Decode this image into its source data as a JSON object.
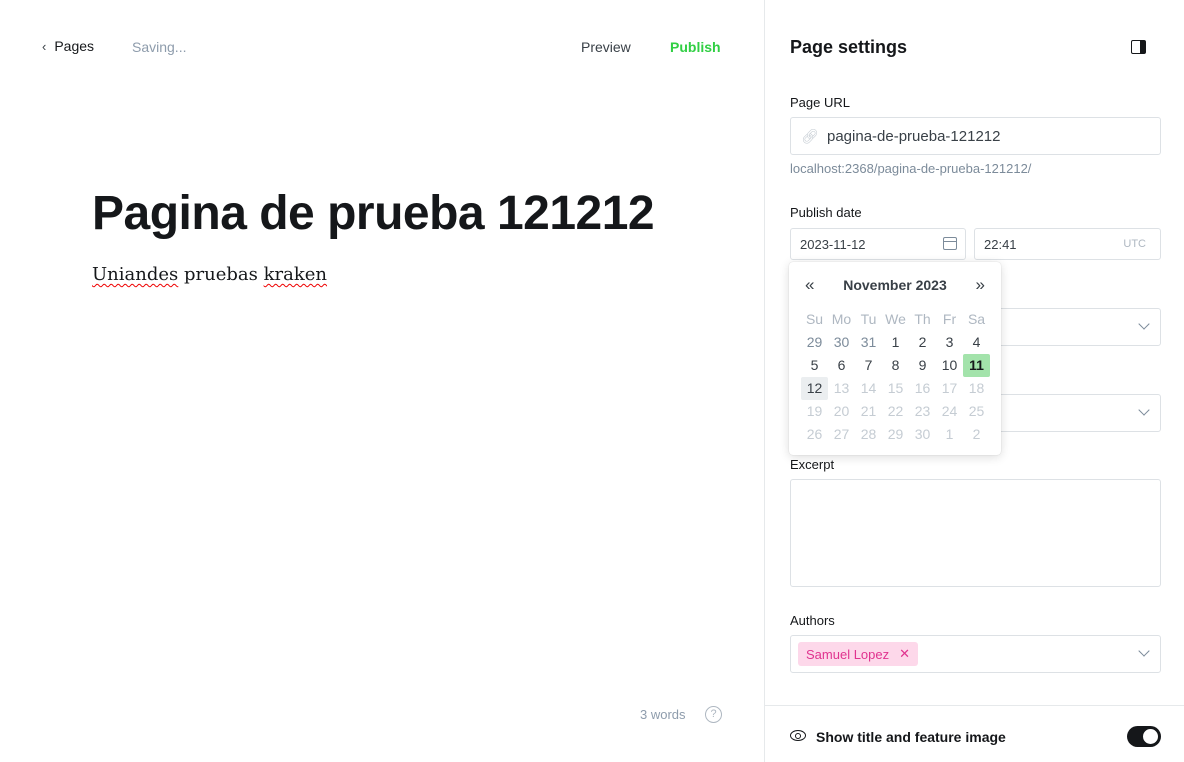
{
  "editor": {
    "back_label": "Pages",
    "status": "Saving...",
    "preview_label": "Preview",
    "publish_label": "Publish",
    "title": "Pagina de prueba 121212",
    "body_words": [
      "Uniandes",
      "pruebas",
      "kraken"
    ],
    "word_count": "3 words",
    "help_label": "?"
  },
  "settings": {
    "title": "Page settings",
    "url_label": "Page URL",
    "url_value": "pagina-de-prueba-121212",
    "url_hint": "localhost:2368/pagina-de-prueba-121212/",
    "publish_date_label": "Publish date",
    "date_value": "2023-11-12",
    "time_value": "22:41",
    "timezone": "UTC",
    "excerpt_label": "Excerpt",
    "excerpt_value": "",
    "authors_label": "Authors",
    "authors": [
      "Samuel Lopez"
    ],
    "show_title_label": "Show title and feature image",
    "show_title_enabled": true
  },
  "datepicker": {
    "prev": "«",
    "next": "»",
    "month": "November 2023",
    "weekdays": [
      "Su",
      "Mo",
      "Tu",
      "We",
      "Th",
      "Fr",
      "Sa"
    ],
    "days": [
      {
        "d": "29",
        "s": "other"
      },
      {
        "d": "30",
        "s": "other"
      },
      {
        "d": "31",
        "s": "other"
      },
      {
        "d": "1",
        "s": ""
      },
      {
        "d": "2",
        "s": ""
      },
      {
        "d": "3",
        "s": ""
      },
      {
        "d": "4",
        "s": ""
      },
      {
        "d": "5",
        "s": ""
      },
      {
        "d": "6",
        "s": ""
      },
      {
        "d": "7",
        "s": ""
      },
      {
        "d": "8",
        "s": ""
      },
      {
        "d": "9",
        "s": ""
      },
      {
        "d": "10",
        "s": ""
      },
      {
        "d": "11",
        "s": "today"
      },
      {
        "d": "12",
        "s": "selected"
      },
      {
        "d": "13",
        "s": "disabled"
      },
      {
        "d": "14",
        "s": "disabled"
      },
      {
        "d": "15",
        "s": "disabled"
      },
      {
        "d": "16",
        "s": "disabled"
      },
      {
        "d": "17",
        "s": "disabled"
      },
      {
        "d": "18",
        "s": "disabled"
      },
      {
        "d": "19",
        "s": "disabled"
      },
      {
        "d": "20",
        "s": "disabled"
      },
      {
        "d": "21",
        "s": "disabled"
      },
      {
        "d": "22",
        "s": "disabled"
      },
      {
        "d": "23",
        "s": "disabled"
      },
      {
        "d": "24",
        "s": "disabled"
      },
      {
        "d": "25",
        "s": "disabled"
      },
      {
        "d": "26",
        "s": "disabled"
      },
      {
        "d": "27",
        "s": "disabled"
      },
      {
        "d": "28",
        "s": "disabled"
      },
      {
        "d": "29",
        "s": "disabled"
      },
      {
        "d": "30",
        "s": "disabled"
      },
      {
        "d": "1",
        "s": "disabled"
      },
      {
        "d": "2",
        "s": "disabled"
      }
    ]
  },
  "colors": {
    "publish_accent": "#30cf43",
    "today_highlight": "#a3e3ab",
    "author_chip_bg": "#fdd8ea",
    "author_chip_text": "#e0338f"
  }
}
